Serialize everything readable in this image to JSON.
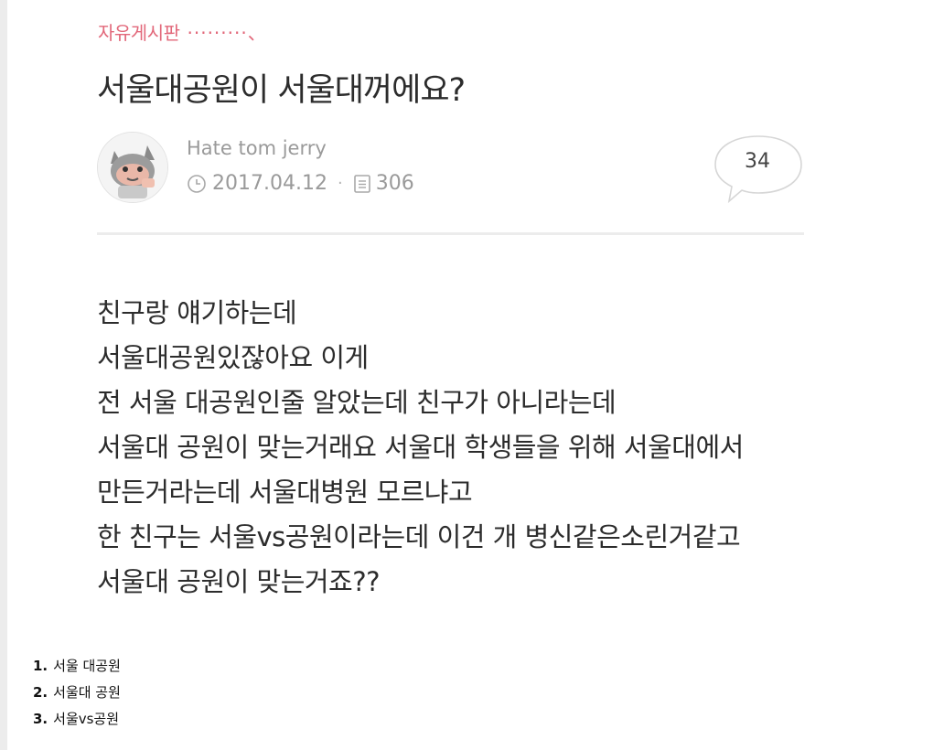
{
  "post": {
    "board": "자유게시판",
    "board_suffix": "·········、",
    "title": "서울대공원이 서울대꺼에요?",
    "author": "Hate tom jerry",
    "date": "2017.04.12",
    "views": "306",
    "comment_count": "34",
    "icons": {
      "avatar": "avatar-cat",
      "date": "clock-icon",
      "views": "document-icon",
      "comments": "speech-bubble-icon"
    }
  },
  "content": {
    "lines": [
      "친구랑 얘기하는데",
      "서울대공원있잖아요 이게",
      "전 서울 대공원인줄 알았는데 친구가 아니라는데",
      "서울대 공원이 맞는거래요 서울대 학생들을 위해 서울대에서",
      "만든거라는데 서울대병원 모르냐고",
      "한 친구는 서울vs공원이라는데 이건 개 병신같은소린거같고",
      "서울대 공원이 맞는거죠??"
    ]
  },
  "options": [
    {
      "number": "1.",
      "text": "서울 대공원"
    },
    {
      "number": "2.",
      "text": "서울대 공원"
    },
    {
      "number": "3.",
      "text": "서울vs공원"
    }
  ],
  "colors": {
    "accent": "#e2687a",
    "text": "#2c2c2c",
    "meta": "#9a9a9a"
  }
}
